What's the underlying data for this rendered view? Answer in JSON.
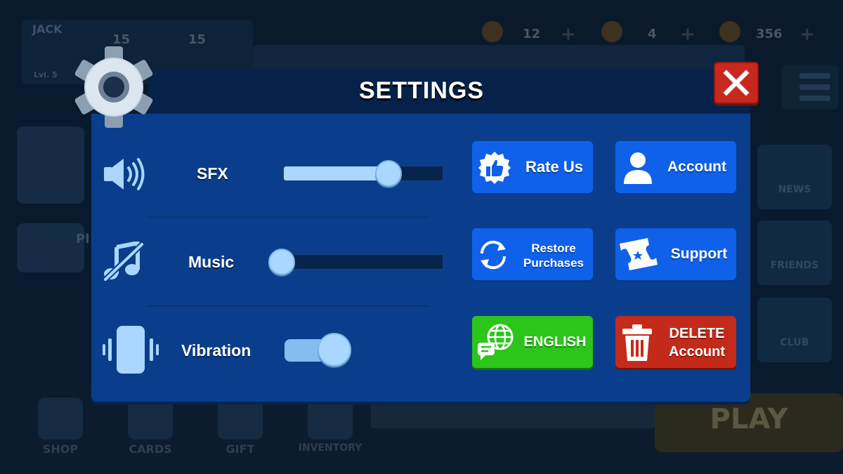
{
  "background": {
    "player_name": "JACK",
    "player_level": "Lvl. 5",
    "stat_trophies": "15",
    "stat_second": "15",
    "resources": [
      {
        "icon": "lightning-icon",
        "value": "12"
      },
      {
        "icon": "wood-icon",
        "value": "4"
      },
      {
        "icon": "coin-icon",
        "value": "356"
      }
    ],
    "side_buttons": [
      "NEWS",
      "FRIENDS",
      "CLUB"
    ],
    "bottom_nav": [
      "SHOP",
      "CARDS",
      "GIFT",
      "INVENTORY"
    ],
    "play_label": "PLAY",
    "partial_label": "Pl"
  },
  "dialog": {
    "title": "SETTINGS",
    "settings": {
      "sfx": {
        "label": "SFX",
        "level": 0.68
      },
      "music": {
        "label": "Music",
        "level": 0.0
      },
      "vibration": {
        "label": "Vibration",
        "enabled": true
      }
    },
    "buttons": {
      "rate_us": "Rate Us",
      "account": "Account",
      "restore_line1": "Restore",
      "restore_line2": "Purchases",
      "support": "Support",
      "language": "ENGLISH",
      "delete_line1": "DELETE",
      "delete_line2": "Account"
    }
  },
  "colors": {
    "panel": "#0a3e8c",
    "header": "#06214a",
    "button_blue": "#1061ea",
    "button_green": "#2cc51a",
    "button_red": "#c42a1a",
    "slider": "#a9d7ff"
  }
}
